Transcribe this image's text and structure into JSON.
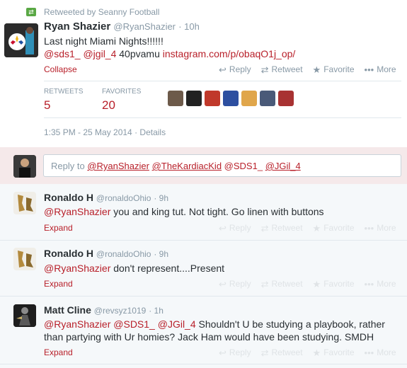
{
  "retweet": {
    "label": "Retweeted by Seanny Football"
  },
  "main_tweet": {
    "name": "Ryan Shazier",
    "handle": "@RyanShazier",
    "time": "· 10h",
    "line1": "Last night Miami Nights!!!!!!",
    "mention1": "@sds1_",
    "mention2": "@jgil_4",
    "text_after": "40pvamu",
    "url": "instagram.com/p/obaqO1j_op/",
    "collapse": "Collapse"
  },
  "actions": {
    "reply": "Reply",
    "retweet": "Retweet",
    "favorite": "Favorite",
    "more": "More"
  },
  "stats": {
    "retweets_label": "RETWEETS",
    "retweets": "5",
    "favorites_label": "FAVORITES",
    "favorites": "20"
  },
  "timestamp": "1:35 PM - 25 May 2014",
  "details": "Details",
  "reply_box": {
    "prefix": "Reply to",
    "m1": "@RyanShazier",
    "m2": "@TheKardiacKid",
    "m3": "@SDS1_",
    "m4": "@JGil_4"
  },
  "replies": [
    {
      "name": "Ronaldo H",
      "handle": "@ronaldoOhio",
      "time": "· 9h",
      "mention": "@RyanShazier",
      "text": "you and king tut. Not tight. Go linen with buttons",
      "expand": "Expand"
    },
    {
      "name": "Ronaldo H",
      "handle": "@ronaldoOhio",
      "time": "· 9h",
      "mention": "@RyanShazier",
      "text": "don't represent....Present",
      "expand": "Expand"
    },
    {
      "name": "Matt Cline",
      "handle": "@revsyz1019",
      "time": "· 1h",
      "mention": "@RyanShazier",
      "mention2": "@SDS1_",
      "mention3": "@JGil_4",
      "text": "Shouldn't U be studying a playbook, rather",
      "text2": "than partying with Ur homies? Jack Ham would have been studying. SMDH",
      "expand": "Expand"
    }
  ],
  "colors": {
    "accent": "#b8202a",
    "muted": "#8899a6",
    "text": "#292f33"
  }
}
